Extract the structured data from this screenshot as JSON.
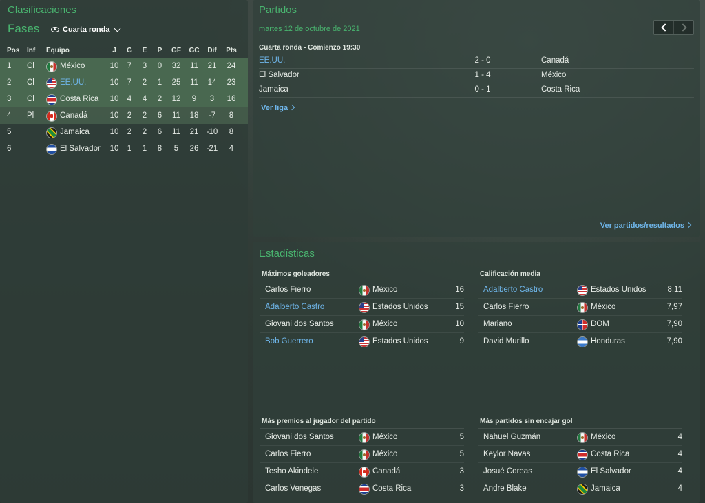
{
  "left": {
    "title": "Clasificaciones",
    "fases_label": "Fases",
    "stage_select": "Cuarta ronda",
    "headers": {
      "pos": "Pos",
      "inf": "Inf",
      "team": "Equipo",
      "j": "J",
      "g": "G",
      "e": "E",
      "p": "P",
      "gf": "GF",
      "gc": "GC",
      "dif": "Dif",
      "pts": "Pts"
    },
    "rows": [
      {
        "pos": "1",
        "inf": "Cl",
        "team": "México",
        "flag": "mx",
        "j": "10",
        "g": "7",
        "e": "3",
        "p": "0",
        "gf": "32",
        "gc": "11",
        "dif": "21",
        "pts": "24"
      },
      {
        "pos": "2",
        "inf": "Cl",
        "team": "EE.UU.",
        "flag": "us",
        "j": "10",
        "g": "7",
        "e": "2",
        "p": "1",
        "gf": "25",
        "gc": "11",
        "dif": "14",
        "pts": "23"
      },
      {
        "pos": "3",
        "inf": "Cl",
        "team": "Costa Rica",
        "flag": "cr",
        "j": "10",
        "g": "4",
        "e": "4",
        "p": "2",
        "gf": "12",
        "gc": "9",
        "dif": "3",
        "pts": "16"
      },
      {
        "pos": "4",
        "inf": "Pl",
        "team": "Canadá",
        "flag": "ca",
        "j": "10",
        "g": "2",
        "e": "2",
        "p": "6",
        "gf": "11",
        "gc": "18",
        "dif": "-7",
        "pts": "8"
      },
      {
        "pos": "5",
        "inf": "",
        "team": "Jamaica",
        "flag": "jm",
        "j": "10",
        "g": "2",
        "e": "2",
        "p": "6",
        "gf": "11",
        "gc": "21",
        "dif": "-10",
        "pts": "8"
      },
      {
        "pos": "6",
        "inf": "",
        "team": "El Salvador",
        "flag": "sv",
        "j": "10",
        "g": "1",
        "e": "1",
        "p": "8",
        "gf": "5",
        "gc": "26",
        "dif": "-21",
        "pts": "4"
      }
    ]
  },
  "partidos": {
    "title": "Partidos",
    "date": "martes 12 de octubre de 2021",
    "round": "Cuarta ronda - Comienzo 19:30",
    "matches": [
      {
        "home": "EE.UU.",
        "score": "2 - 0",
        "away": "Canadá"
      },
      {
        "home": "El Salvador",
        "score": "1 - 4",
        "away": "México"
      },
      {
        "home": "Jamaica",
        "score": "0 - 1",
        "away": "Costa Rica"
      }
    ],
    "ver_liga": "Ver liga",
    "ver_partidos": "Ver partidos/resultados"
  },
  "stats": {
    "title": "Estadísticas",
    "blocks": [
      {
        "heading": "Máximos goleadores",
        "rows": [
          {
            "name": "Carlos Fierro",
            "flag": "mx",
            "nat": "México",
            "val": "16"
          },
          {
            "name": "Adalberto Castro",
            "flag": "us",
            "nat": "Estados Unidos",
            "val": "15"
          },
          {
            "name": "Giovani dos Santos",
            "flag": "mx",
            "nat": "México",
            "val": "10"
          },
          {
            "name": "Bob Guerrero",
            "flag": "us",
            "nat": "Estados Unidos",
            "val": "9"
          }
        ]
      },
      {
        "heading": "Calificación media",
        "rows": [
          {
            "name": "Adalberto Castro",
            "flag": "us",
            "nat": "Estados Unidos",
            "val": "8,11"
          },
          {
            "name": "Carlos Fierro",
            "flag": "mx",
            "nat": "México",
            "val": "7,97"
          },
          {
            "name": "Mariano",
            "flag": "do",
            "nat": "DOM",
            "val": "7,90"
          },
          {
            "name": "David Murillo",
            "flag": "hn",
            "nat": "Honduras",
            "val": "7,90"
          }
        ]
      },
      {
        "heading": "Más premios al jugador del partido",
        "rows": [
          {
            "name": "Giovani dos Santos",
            "flag": "mx",
            "nat": "México",
            "val": "5"
          },
          {
            "name": "Carlos Fierro",
            "flag": "mx",
            "nat": "México",
            "val": "5"
          },
          {
            "name": "Tesho Akindele",
            "flag": "ca",
            "nat": "Canadá",
            "val": "3"
          },
          {
            "name": "Carlos Venegas",
            "flag": "cr",
            "nat": "Costa Rica",
            "val": "3"
          }
        ]
      },
      {
        "heading": "Más partidos sin encajar gol",
        "rows": [
          {
            "name": "Nahuel Guzmán",
            "flag": "mx",
            "nat": "México",
            "val": "4"
          },
          {
            "name": "Keylor Navas",
            "flag": "cr",
            "nat": "Costa Rica",
            "val": "4"
          },
          {
            "name": "Josué Coreas",
            "flag": "sv",
            "nat": "El Salvador",
            "val": "4"
          },
          {
            "name": "Andre Blake",
            "flag": "jm",
            "nat": "Jamaica",
            "val": "4"
          }
        ]
      }
    ]
  }
}
